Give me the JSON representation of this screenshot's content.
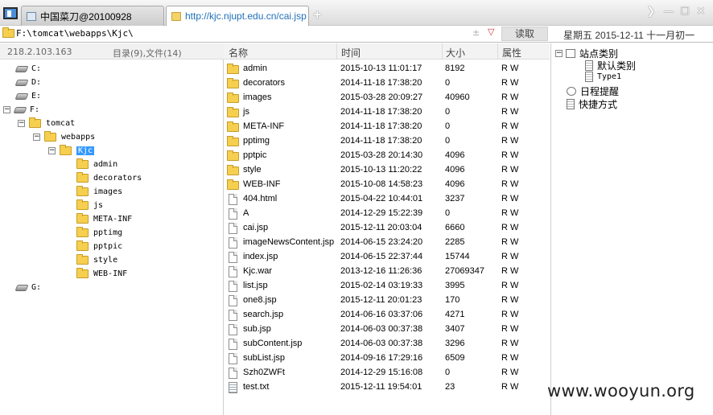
{
  "tabs": [
    {
      "label": "中国菜刀@20100928"
    },
    {
      "label": "http://kjc.njupt.edu.cn/cai.jsp"
    }
  ],
  "new_tab_label": "+",
  "window_controls": {
    "scroll": "❯",
    "minimize": "—",
    "maximize": "☐",
    "close": "✕"
  },
  "pathbar": {
    "path": "F:\\tomcat\\webapps\\Kjc\\",
    "ops": "±",
    "dropdown": "▽",
    "read_button": "读取"
  },
  "date_text": "星期五 2015-12-11 十一月初一",
  "left_header": {
    "ip": "218.2.103.163",
    "counts": "目录(9),文件(14)"
  },
  "tree": {
    "drive_c": "C:",
    "drive_d": "D:",
    "drive_e": "E:",
    "drive_f": "F:",
    "tomcat": "tomcat",
    "webapps": "webapps",
    "kjc": "Kjc",
    "kjc_children": [
      "admin",
      "decorators",
      "images",
      "js",
      "META-INF",
      "pptimg",
      "pptpic",
      "style",
      "WEB-INF"
    ],
    "drive_g": "G:",
    "expand_minus": "−",
    "expand_plus": "+"
  },
  "file_columns": {
    "name": "名称",
    "time": "时间",
    "size": "大小",
    "attr": "属性"
  },
  "files": [
    {
      "type": "folder",
      "name": "admin",
      "time": "2015-10-13 11:01:17",
      "size": "8192",
      "attr": "R W"
    },
    {
      "type": "folder",
      "name": "decorators",
      "time": "2014-11-18 17:38:20",
      "size": "0",
      "attr": "R W"
    },
    {
      "type": "folder",
      "name": "images",
      "time": "2015-03-28 20:09:27",
      "size": "40960",
      "attr": "R W"
    },
    {
      "type": "folder",
      "name": "js",
      "time": "2014-11-18 17:38:20",
      "size": "0",
      "attr": "R W"
    },
    {
      "type": "folder",
      "name": "META-INF",
      "time": "2014-11-18 17:38:20",
      "size": "0",
      "attr": "R W"
    },
    {
      "type": "folder",
      "name": "pptimg",
      "time": "2014-11-18 17:38:20",
      "size": "0",
      "attr": "R W"
    },
    {
      "type": "folder",
      "name": "pptpic",
      "time": "2015-03-28 20:14:30",
      "size": "4096",
      "attr": "R W"
    },
    {
      "type": "folder",
      "name": "style",
      "time": "2015-10-13 11:20:22",
      "size": "4096",
      "attr": "R W"
    },
    {
      "type": "folder",
      "name": "WEB-INF",
      "time": "2015-10-08 14:58:23",
      "size": "4096",
      "attr": "R W"
    },
    {
      "type": "file",
      "name": "404.html",
      "time": "2015-04-22 10:44:01",
      "size": "3237",
      "attr": "R W"
    },
    {
      "type": "file",
      "name": "A",
      "time": "2014-12-29 15:22:39",
      "size": "0",
      "attr": "R W"
    },
    {
      "type": "file",
      "name": "cai.jsp",
      "time": "2015-12-11 20:03:04",
      "size": "6660",
      "attr": "R W"
    },
    {
      "type": "file",
      "name": "imageNewsContent.jsp",
      "time": "2014-06-15 23:24:20",
      "size": "2285",
      "attr": "R W"
    },
    {
      "type": "file",
      "name": "index.jsp",
      "time": "2014-06-15 22:37:44",
      "size": "15744",
      "attr": "R W"
    },
    {
      "type": "file",
      "name": "Kjc.war",
      "time": "2013-12-16 11:26:36",
      "size": "27069347",
      "attr": "R W"
    },
    {
      "type": "file",
      "name": "list.jsp",
      "time": "2015-02-14 03:19:33",
      "size": "3995",
      "attr": "R W"
    },
    {
      "type": "file",
      "name": "one8.jsp",
      "time": "2015-12-11 20:01:23",
      "size": "170",
      "attr": "R W"
    },
    {
      "type": "file",
      "name": "search.jsp",
      "time": "2014-06-16 03:37:06",
      "size": "4271",
      "attr": "R W"
    },
    {
      "type": "file",
      "name": "sub.jsp",
      "time": "2014-06-03 00:37:38",
      "size": "3407",
      "attr": "R W"
    },
    {
      "type": "file",
      "name": "subContent.jsp",
      "time": "2014-06-03 00:37:38",
      "size": "3296",
      "attr": "R W"
    },
    {
      "type": "file",
      "name": "subList.jsp",
      "time": "2014-09-16 17:29:16",
      "size": "6509",
      "attr": "R W"
    },
    {
      "type": "file",
      "name": "Szh0ZWFt",
      "time": "2014-12-29 15:16:08",
      "size": "0",
      "attr": "R W"
    },
    {
      "type": "text",
      "name": "test.txt",
      "time": "2015-12-11 19:54:01",
      "size": "23",
      "attr": "R W"
    }
  ],
  "right_tree": {
    "site_category": "站点类别",
    "default_category": "默认类别",
    "type1": "Type1",
    "schedule": "日程提醒",
    "shortcuts": "快捷方式"
  },
  "watermark": "www.wooyun.org"
}
